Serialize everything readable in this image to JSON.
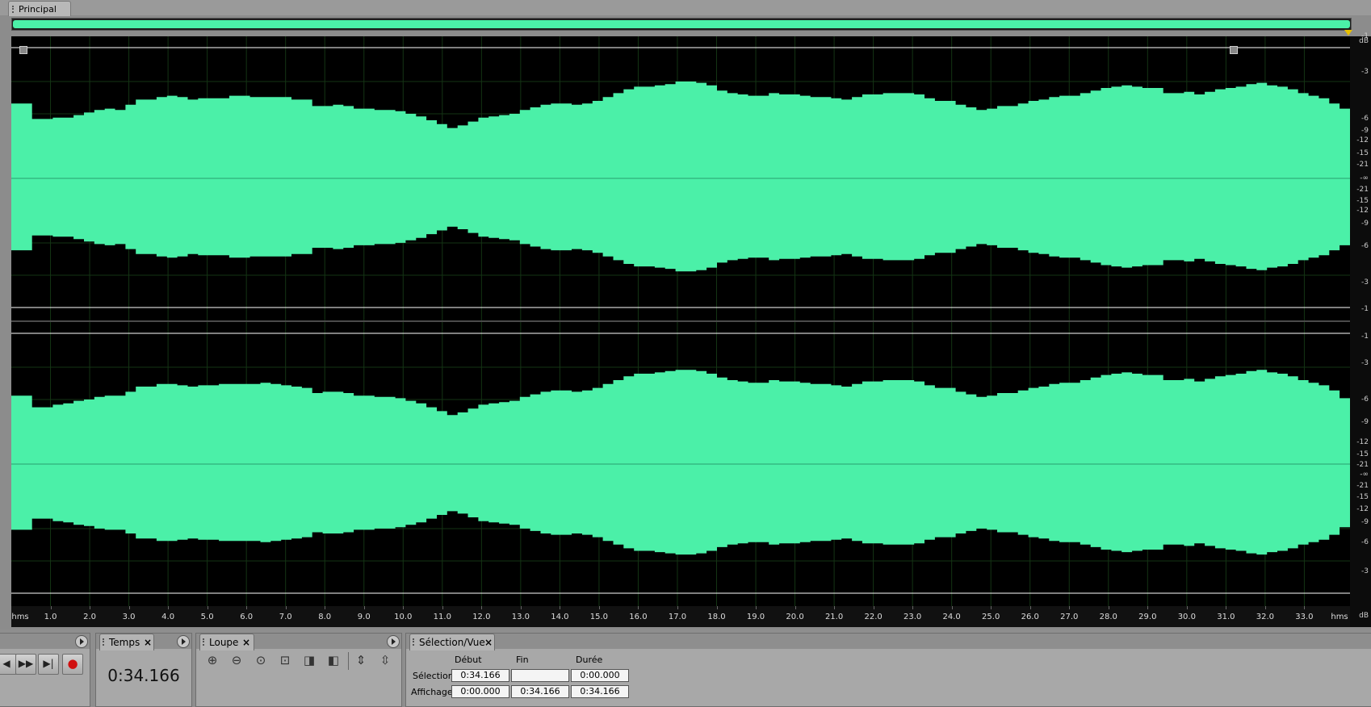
{
  "main_tab": {
    "label": "Principal"
  },
  "colors": {
    "waveform": "#4bf0a8",
    "background": "#000000"
  },
  "timeline": {
    "unit_left": "hms",
    "unit_right": "hms",
    "ticks": [
      "1.0",
      "2.0",
      "3.0",
      "4.0",
      "5.0",
      "6.0",
      "7.0",
      "8.0",
      "9.0",
      "10.0",
      "11.0",
      "12.0",
      "13.0",
      "14.0",
      "15.0",
      "16.0",
      "17.0",
      "18.0",
      "19.0",
      "20.0",
      "21.0",
      "22.0",
      "23.0",
      "24.0",
      "25.0",
      "26.0",
      "27.0",
      "28.0",
      "29.0",
      "30.0",
      "31.0",
      "32.0",
      "33.0"
    ]
  },
  "db_scale": {
    "unit_top": "dB",
    "unit_bottom": "dB",
    "channel1_labels": [
      "-1",
      "-3",
      "-6",
      "-9",
      "-12",
      "-15",
      "-21",
      "-∞",
      "-21",
      "-15",
      "-12",
      "-9",
      "-6",
      "-3",
      "-1"
    ],
    "channel2_labels": [
      "-1",
      "-3",
      "-6",
      "-9",
      "-12",
      "-15",
      "-21",
      "-∞",
      "-21",
      "-15",
      "-12",
      "-9",
      "-6",
      "-3"
    ]
  },
  "waveform": {
    "channel1_amplitude": [
      0.58,
      0.58,
      0.46,
      0.46,
      0.47,
      0.47,
      0.49,
      0.51,
      0.53,
      0.54,
      0.53,
      0.57,
      0.61,
      0.61,
      0.63,
      0.64,
      0.63,
      0.61,
      0.62,
      0.62,
      0.62,
      0.64,
      0.64,
      0.63,
      0.63,
      0.63,
      0.63,
      0.61,
      0.61,
      0.56,
      0.56,
      0.57,
      0.56,
      0.54,
      0.54,
      0.53,
      0.53,
      0.52,
      0.5,
      0.48,
      0.45,
      0.42,
      0.39,
      0.41,
      0.44,
      0.47,
      0.48,
      0.49,
      0.5,
      0.53,
      0.55,
      0.57,
      0.58,
      0.58,
      0.57,
      0.58,
      0.6,
      0.63,
      0.66,
      0.69,
      0.71,
      0.71,
      0.72,
      0.73,
      0.75,
      0.75,
      0.74,
      0.72,
      0.68,
      0.66,
      0.65,
      0.64,
      0.64,
      0.66,
      0.65,
      0.65,
      0.64,
      0.63,
      0.63,
      0.62,
      0.61,
      0.63,
      0.65,
      0.65,
      0.66,
      0.66,
      0.66,
      0.65,
      0.62,
      0.6,
      0.6,
      0.57,
      0.55,
      0.53,
      0.54,
      0.56,
      0.56,
      0.58,
      0.6,
      0.61,
      0.63,
      0.64,
      0.64,
      0.66,
      0.68,
      0.7,
      0.71,
      0.72,
      0.71,
      0.7,
      0.7,
      0.66,
      0.66,
      0.67,
      0.65,
      0.67,
      0.69,
      0.7,
      0.71,
      0.73,
      0.74,
      0.72,
      0.71,
      0.69,
      0.66,
      0.64,
      0.62,
      0.58,
      0.54
    ],
    "channel2_amplitude": [
      0.53,
      0.53,
      0.44,
      0.44,
      0.46,
      0.47,
      0.49,
      0.5,
      0.52,
      0.53,
      0.53,
      0.56,
      0.6,
      0.6,
      0.62,
      0.62,
      0.61,
      0.6,
      0.61,
      0.61,
      0.62,
      0.62,
      0.62,
      0.62,
      0.63,
      0.62,
      0.61,
      0.6,
      0.59,
      0.55,
      0.56,
      0.56,
      0.55,
      0.53,
      0.53,
      0.52,
      0.52,
      0.51,
      0.49,
      0.47,
      0.44,
      0.41,
      0.38,
      0.4,
      0.43,
      0.46,
      0.47,
      0.48,
      0.49,
      0.52,
      0.54,
      0.56,
      0.57,
      0.57,
      0.56,
      0.57,
      0.59,
      0.62,
      0.65,
      0.68,
      0.7,
      0.7,
      0.71,
      0.72,
      0.73,
      0.73,
      0.72,
      0.7,
      0.67,
      0.65,
      0.64,
      0.63,
      0.63,
      0.65,
      0.64,
      0.64,
      0.63,
      0.62,
      0.62,
      0.61,
      0.6,
      0.62,
      0.64,
      0.64,
      0.65,
      0.65,
      0.65,
      0.64,
      0.61,
      0.59,
      0.59,
      0.56,
      0.54,
      0.52,
      0.53,
      0.55,
      0.55,
      0.57,
      0.59,
      0.6,
      0.62,
      0.63,
      0.63,
      0.65,
      0.67,
      0.69,
      0.7,
      0.71,
      0.7,
      0.69,
      0.69,
      0.65,
      0.65,
      0.66,
      0.64,
      0.66,
      0.68,
      0.69,
      0.7,
      0.72,
      0.73,
      0.71,
      0.7,
      0.68,
      0.65,
      0.63,
      0.61,
      0.57,
      0.51
    ]
  },
  "transport": {
    "buttons": [
      "prev-icon",
      "fast-forward-icon",
      "skip-end-icon",
      "record-icon"
    ],
    "symbols": [
      "◀",
      "▶▶",
      "▶|",
      "●"
    ]
  },
  "time_panel": {
    "tab_label": "Temps",
    "close": "×",
    "value": "0:34.166"
  },
  "zoom_panel": {
    "tab_label": "Loupe",
    "close": "×",
    "buttons": [
      "zoom-in-amplitude-icon",
      "zoom-out-amplitude-icon",
      "zoom-out-full-icon",
      "zoom-selection-icon",
      "zoom-left-edge-icon",
      "zoom-right-edge-icon",
      "zoom-in-vertical-icon",
      "zoom-out-vertical-icon"
    ],
    "symbols": [
      "⊕",
      "⊖",
      "⊙",
      "⊡",
      "◨",
      "◧",
      "⇕",
      "⇳"
    ]
  },
  "selection_panel": {
    "tab_label": "Sélection/Vue",
    "close": "×",
    "col_start": "Début",
    "col_end": "Fin",
    "col_duration": "Durée",
    "row_selection": "Sélection",
    "row_view": "Affichage",
    "selection_start": "0:34.166",
    "selection_end": "",
    "selection_duration": "0:00.000",
    "view_start": "0:00.000",
    "view_end": "0:34.166",
    "view_duration": "0:34.166"
  }
}
